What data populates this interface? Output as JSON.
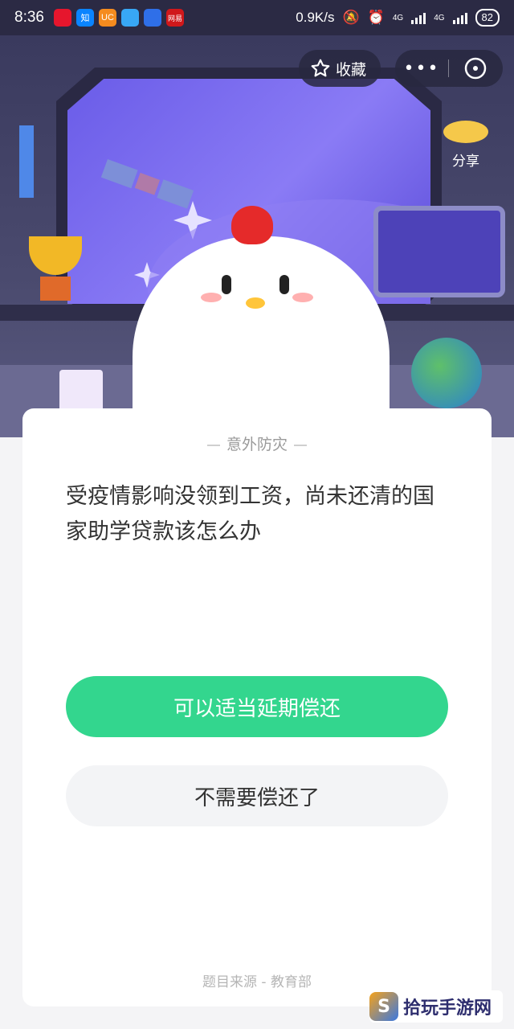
{
  "status_bar": {
    "time": "8:36",
    "app_icons": [
      {
        "name": "weibo-icon",
        "label": "",
        "color": "#e6162d"
      },
      {
        "name": "zhihu-icon",
        "label": "知",
        "color": "#0a84ff"
      },
      {
        "name": "uc-icon",
        "label": "UC",
        "color": "#f58b1f"
      },
      {
        "name": "browser-icon",
        "label": "",
        "color": "#38a7f5"
      },
      {
        "name": "baidu-icon",
        "label": "",
        "color": "#2f6fe8"
      },
      {
        "name": "netease-icon",
        "label": "网易",
        "color": "#d0181b"
      }
    ],
    "speed": "0.9K/s",
    "network1": "4G",
    "network2": "4G",
    "battery": "82"
  },
  "header": {
    "favorite_label": "收藏",
    "more_label": "•••",
    "share_label": "分享"
  },
  "card": {
    "category": "意外防灾",
    "question": "受疫情影响没领到工资，尚未还清的国家助学贷款该怎么办",
    "options": [
      {
        "label": "可以适当延期偿还"
      },
      {
        "label": "不需要偿还了"
      }
    ],
    "source": "题目来源 - 教育部"
  },
  "watermark": {
    "logo_letter": "S",
    "text": "拾玩手游网"
  },
  "colors": {
    "accent_green": "#33d68e",
    "hero_bg": "#3a3a5e"
  }
}
